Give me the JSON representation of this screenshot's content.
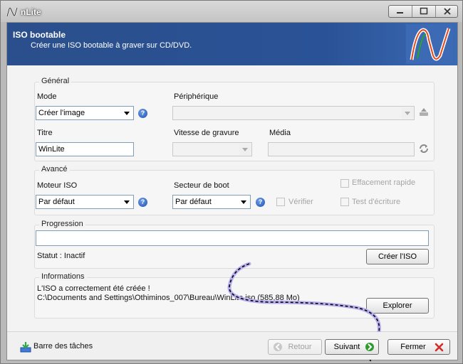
{
  "window": {
    "title": "nLite"
  },
  "header": {
    "title": "ISO bootable",
    "subtitle": "Créer une ISO bootable à graver sur CD/DVD."
  },
  "general": {
    "title": "Général",
    "mode_label": "Mode",
    "mode_value": "Créer l'image",
    "device_label": "Périphérique",
    "device_value": "",
    "title_label": "Titre",
    "title_value": "WinLite",
    "speed_label": "Vitesse de gravure",
    "speed_value": "",
    "media_label": "Média",
    "media_value": ""
  },
  "advanced": {
    "title": "Avancé",
    "iso_engine_label": "Moteur ISO",
    "iso_engine_value": "Par défaut",
    "boot_sector_label": "Secteur de boot",
    "boot_sector_value": "Par défaut",
    "quick_erase_label": "Effacement rapide",
    "verify_label": "Vérifier",
    "write_test_label": "Test d'écriture"
  },
  "progress": {
    "title": "Progression",
    "status_text": "Statut : Inactif",
    "create_iso_button": "Créer l'ISO"
  },
  "info": {
    "title": "Informations",
    "line1": "L'ISO a correctement été créée !",
    "line2": "C:\\Documents and Settings\\Othiminos_007\\Bureau\\WinLite.iso (585,88 Mo)",
    "explore_button": "Explorer"
  },
  "footer": {
    "taskbar_label": "Barre des tâches",
    "back_button": "Retour",
    "next_button": "Suivant",
    "close_button": "Fermer"
  },
  "colors": {
    "header_blue": "#2a5296",
    "help_blue": "#1d4fb3",
    "close_red": "#d22b2b",
    "next_green": "#2f9a2f"
  }
}
